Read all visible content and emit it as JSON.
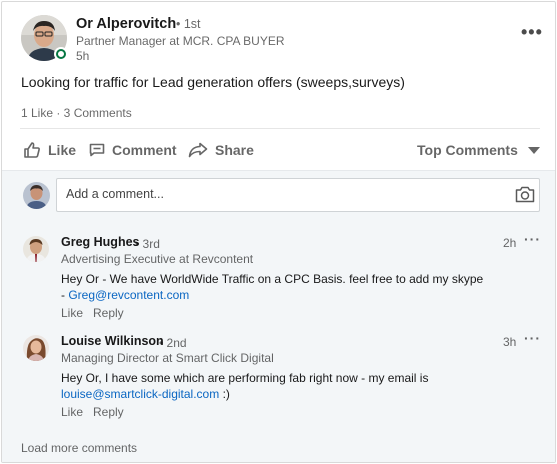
{
  "post": {
    "author_name": "Or Alperovitch",
    "author_degree": "• 1st",
    "author_headline": "Partner Manager at MCR. CPA BUYER",
    "time": "5h",
    "more_label": "•••",
    "text": "Looking for traffic for Lead generation offers (sweeps,surveys)",
    "counts": "1 Like · 3 Comments"
  },
  "actions": {
    "like": "Like",
    "comment": "Comment",
    "share": "Share",
    "sort": "Top Comments"
  },
  "comment_input": {
    "placeholder": "Add a comment..."
  },
  "comments": [
    {
      "name": "Greg Hughes",
      "degree": "• 3rd",
      "headline": "Advertising Executive at Revcontent",
      "time": "2h",
      "text_line1": "Hey Or - We have WorldWide Traffic on a CPC Basis. feel free to add my skype",
      "text_prefix": "- ",
      "link": "Greg@revcontent.com",
      "text_suffix": "",
      "like": "Like",
      "reply": "Reply"
    },
    {
      "name": "Louise Wilkinson",
      "degree": "• 2nd",
      "headline": "Managing Director at Smart Click Digital",
      "time": "3h",
      "text_line1": "Hey Or, I have some which are performing fab right now - my email is",
      "text_prefix": "",
      "link": "louise@smartclick-digital.com",
      "text_suffix": " :)",
      "like": "Like",
      "reply": "Reply"
    }
  ],
  "load_more": "Load more comments",
  "colors": {
    "link": "#0a66c2",
    "online": "#057642",
    "comments_bg": "#f3f6f8"
  }
}
